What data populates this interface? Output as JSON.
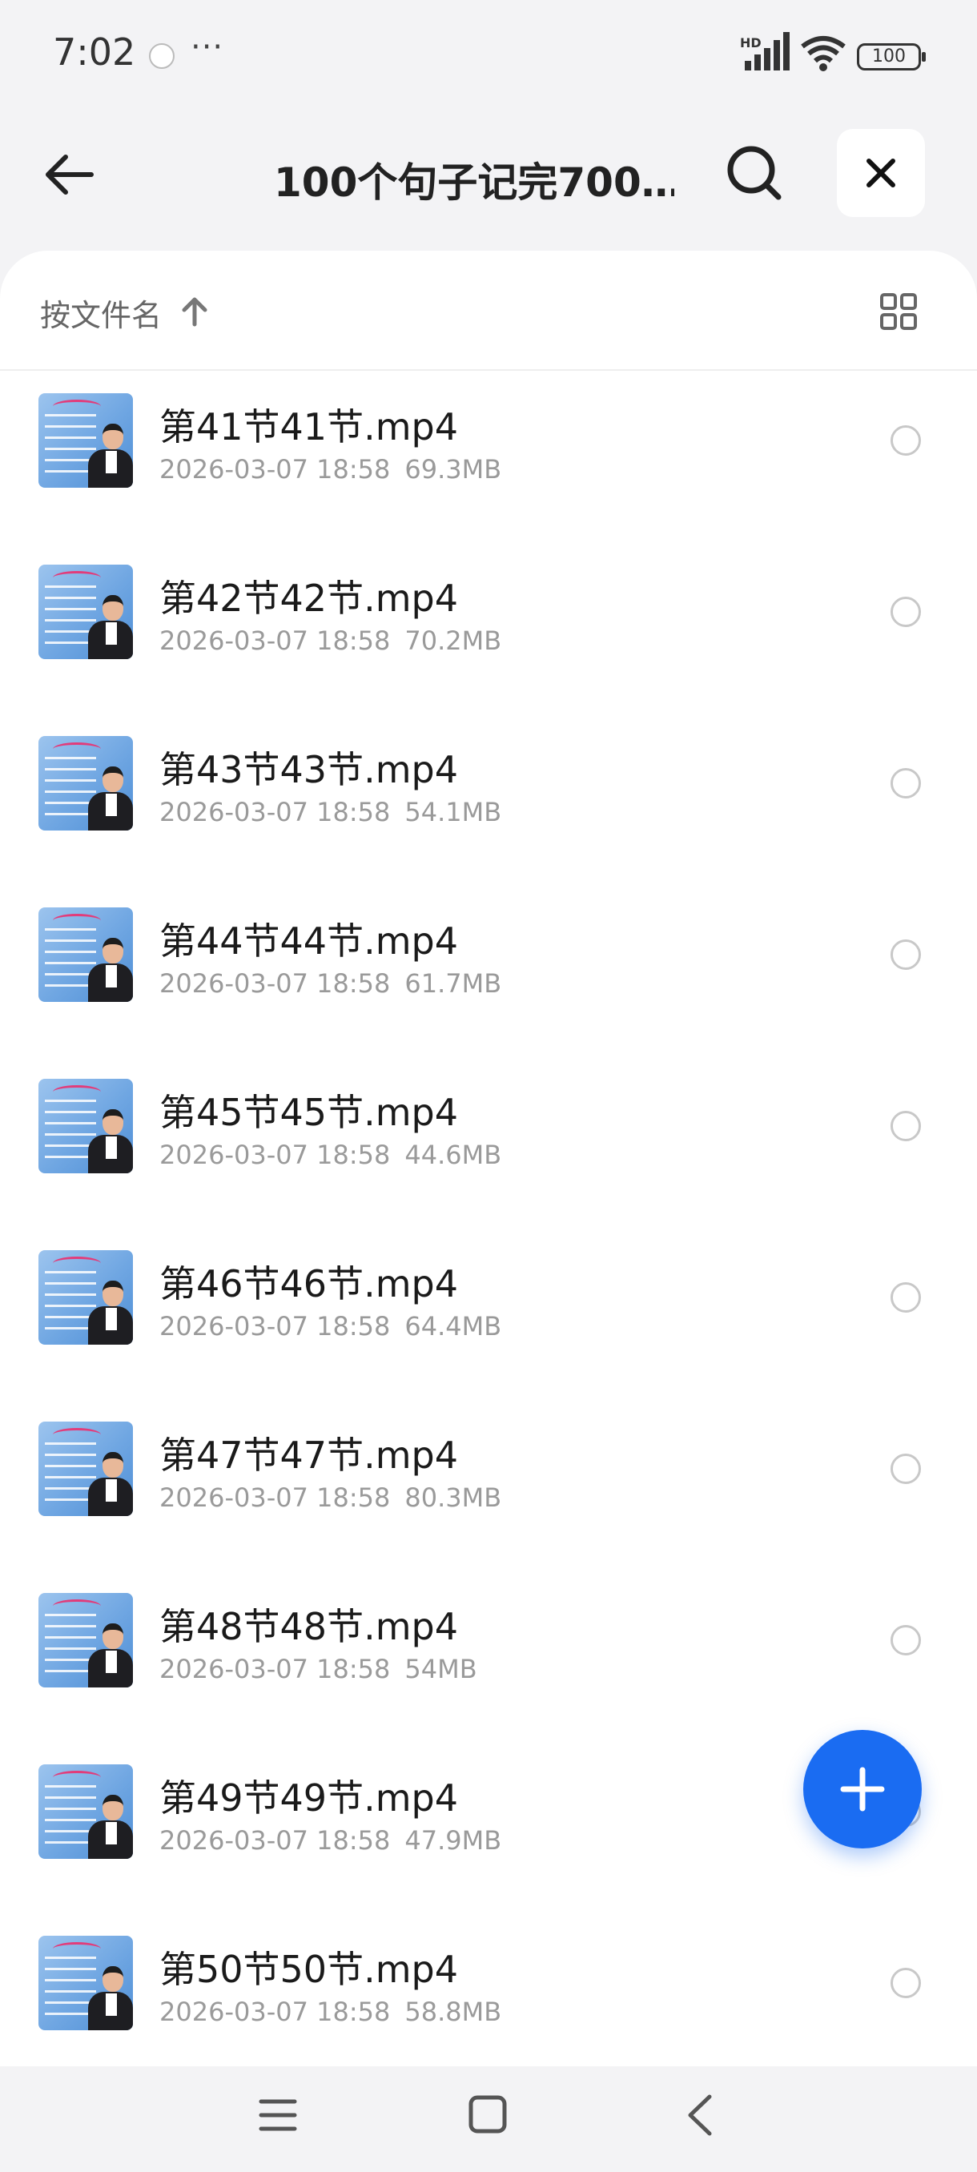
{
  "status_bar": {
    "time": "7:02",
    "overflow": "···",
    "network": "HD",
    "battery": "100"
  },
  "header": {
    "title": "100个句子记完700…",
    "icons": [
      "back-arrow-icon",
      "search-icon",
      "close-icon"
    ]
  },
  "sort": {
    "label": "按文件名",
    "direction": "ascending",
    "view_toggle_icon": "grid-view-icon"
  },
  "files": [
    {
      "name": "第41节41节.mp4",
      "date": "2026-03-07 18:58",
      "size": "69.3MB"
    },
    {
      "name": "第42节42节.mp4",
      "date": "2026-03-07 18:58",
      "size": "70.2MB"
    },
    {
      "name": "第43节43节.mp4",
      "date": "2026-03-07 18:58",
      "size": "54.1MB"
    },
    {
      "name": "第44节44节.mp4",
      "date": "2026-03-07 18:58",
      "size": "61.7MB"
    },
    {
      "name": "第45节45节.mp4",
      "date": "2026-03-07 18:58",
      "size": "44.6MB"
    },
    {
      "name": "第46节46节.mp4",
      "date": "2026-03-07 18:58",
      "size": "64.4MB"
    },
    {
      "name": "第47节47节.mp4",
      "date": "2026-03-07 18:58",
      "size": "80.3MB"
    },
    {
      "name": "第48节48节.mp4",
      "date": "2026-03-07 18:58",
      "size": "54MB"
    },
    {
      "name": "第49节49节.mp4",
      "date": "2026-03-07 18:58",
      "size": "47.9MB"
    },
    {
      "name": "第50节50节.mp4",
      "date": "2026-03-07 18:58",
      "size": "58.8MB"
    }
  ],
  "fab_icon": "plus-icon",
  "colors": {
    "accent": "#1a6cf2",
    "background": "#f3f3f5"
  }
}
